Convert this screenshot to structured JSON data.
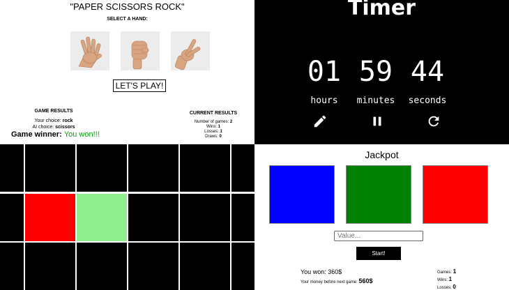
{
  "rps": {
    "title": "\"PAPER SCISSORS ROCK\"",
    "subtitle": "SELECT A HAND:",
    "hands": [
      {
        "name": "paper",
        "icon": "paper-hand-icon"
      },
      {
        "name": "rock",
        "icon": "rock-fist-icon"
      },
      {
        "name": "scissors",
        "icon": "scissors-hand-icon"
      }
    ],
    "play_label": "LET'S PLAY!",
    "game_results_heading": "GAME RESULTS",
    "your_choice_label": "Your choice:",
    "your_choice_value": "rock",
    "ai_choice_label": "AI choice:",
    "ai_choice_value": "scissors",
    "winner_label": "Game winner:",
    "winner_value": "You won!!!",
    "current_results_heading": "CURRENT RESULTS",
    "games_label": "Number of games:",
    "games_value": "2",
    "wins_label": "Wins:",
    "wins_value": "1",
    "losses_label": "Losses:",
    "losses_value": "1",
    "draws_label": "Draws:",
    "draws_value": "0"
  },
  "timer": {
    "title": "Timer",
    "hours": "01",
    "minutes": "59",
    "seconds": "44",
    "hours_label": "hours",
    "minutes_label": "minutes",
    "seconds_label": "seconds",
    "controls": [
      "pencil-edit-icon",
      "pause-icon",
      "refresh-icon"
    ]
  },
  "grid": {
    "rows": 3,
    "columns": 5,
    "cells": [
      {
        "row": 1,
        "col": 0,
        "color": "#ff0000"
      },
      {
        "row": 1,
        "col": 1,
        "color": "#90ee90"
      }
    ],
    "default_color": "#000000"
  },
  "jackpot": {
    "title": "Jackpot",
    "boxes": [
      {
        "name": "blue",
        "color": "#0000ff"
      },
      {
        "name": "green",
        "color": "#008000"
      },
      {
        "name": "red",
        "color": "#ff0000"
      }
    ],
    "input_placeholder": "Value...",
    "start_label": "Start!",
    "won_label": "You won:",
    "won_value": "360$",
    "money_label": "Your money before next game:",
    "money_value": "560$",
    "games_label": "Games:",
    "games_value": "1",
    "wins_label": "Wins:",
    "wins_value": "1",
    "losses_label": "Losses:",
    "losses_value": "0"
  }
}
